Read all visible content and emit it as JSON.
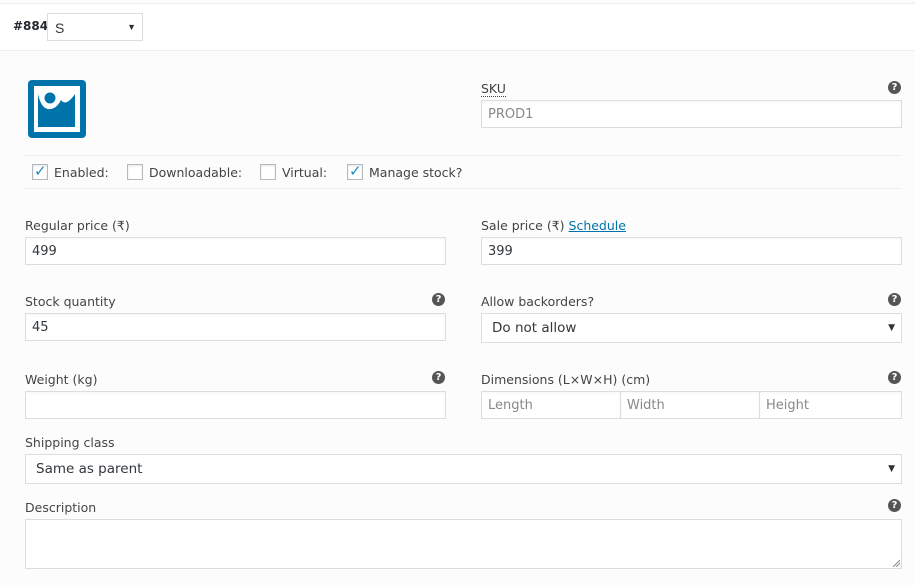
{
  "variation": {
    "id_label": "#884",
    "attribute_value": "S"
  },
  "image": {
    "icon": "image-placeholder-icon"
  },
  "sku": {
    "label": "SKU",
    "value": "PROD1",
    "help_icon": "help-icon"
  },
  "options": [
    {
      "label": "Enabled:",
      "checked": true
    },
    {
      "label": "Downloadable:",
      "checked": false
    },
    {
      "label": "Virtual:",
      "checked": false
    },
    {
      "label": "Manage stock?",
      "checked": true
    }
  ],
  "regular_price": {
    "label": "Regular price (₹)",
    "value": "499"
  },
  "sale_price": {
    "label": "Sale price (₹)",
    "schedule_link": "Schedule",
    "value": "399"
  },
  "stock_quantity": {
    "label": "Stock quantity",
    "value": "45"
  },
  "backorders": {
    "label": "Allow backorders?",
    "value": "Do not allow"
  },
  "weight": {
    "label": "Weight (kg)",
    "value": ""
  },
  "dimensions": {
    "label": "Dimensions (L×W×H) (cm)",
    "length_placeholder": "Length",
    "width_placeholder": "Width",
    "height_placeholder": "Height"
  },
  "shipping_class": {
    "label": "Shipping class",
    "value": "Same as parent"
  },
  "description": {
    "label": "Description",
    "value": ""
  },
  "colors": {
    "accent": "#0073aa",
    "check": "#1e8cbe",
    "icon_blue": "#0073aa"
  }
}
